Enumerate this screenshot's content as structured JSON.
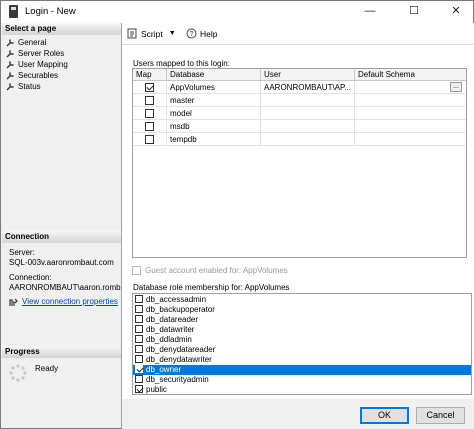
{
  "window": {
    "title": "Login - New",
    "minimize": "—",
    "maximize": "☐",
    "close": "✕"
  },
  "sidebar": {
    "select_page_header": "Select a page",
    "pages": [
      "General",
      "Server Roles",
      "User Mapping",
      "Securables",
      "Status"
    ],
    "connection_header": "Connection",
    "server_label": "Server:",
    "server_value": "SQL-003v.aaronrombaut.com",
    "connection_label": "Connection:",
    "connection_value": "AARONROMBAUT\\aaron.rombau",
    "view_connection_link": "View connection properties",
    "progress_header": "Progress",
    "progress_status": "Ready"
  },
  "toolbar": {
    "script_label": "Script",
    "help_label": "Help"
  },
  "users_mapped": {
    "label": "Users mapped to this login:",
    "columns": [
      "Map",
      "Database",
      "User",
      "Default Schema"
    ],
    "rows": [
      {
        "map": true,
        "database": "AppVolumes",
        "user": "AARONROMBAUT\\AP...",
        "schema": "",
        "ellipsis": "..."
      },
      {
        "map": false,
        "database": "master",
        "user": "",
        "schema": ""
      },
      {
        "map": false,
        "database": "model",
        "user": "",
        "schema": ""
      },
      {
        "map": false,
        "database": "msdb",
        "user": "",
        "schema": ""
      },
      {
        "map": false,
        "database": "tempdb",
        "user": "",
        "schema": ""
      }
    ]
  },
  "guest": {
    "label": "Guest account enabled for: AppVolumes",
    "checked": false
  },
  "roles": {
    "label": "Database role membership for: AppVolumes",
    "items": [
      {
        "name": "db_accessadmin",
        "checked": false,
        "selected": false
      },
      {
        "name": "db_backupoperator",
        "checked": false,
        "selected": false
      },
      {
        "name": "db_datareader",
        "checked": false,
        "selected": false
      },
      {
        "name": "db_datawriter",
        "checked": false,
        "selected": false
      },
      {
        "name": "db_ddladmin",
        "checked": false,
        "selected": false
      },
      {
        "name": "db_denydatareader",
        "checked": false,
        "selected": false
      },
      {
        "name": "db_denydatawriter",
        "checked": false,
        "selected": false
      },
      {
        "name": "db_owner",
        "checked": true,
        "selected": true
      },
      {
        "name": "db_securityadmin",
        "checked": false,
        "selected": false
      },
      {
        "name": "public",
        "checked": true,
        "selected": false
      }
    ]
  },
  "footer": {
    "ok_label": "OK",
    "cancel_label": "Cancel"
  }
}
